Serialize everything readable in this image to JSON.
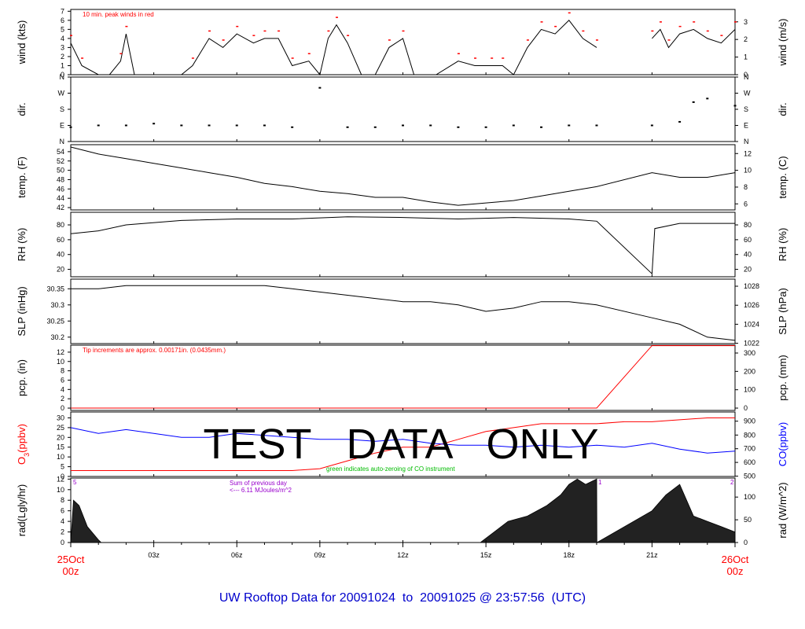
{
  "footer_title": "UW Rooftop Data for 20091024  to  20091025 @ 23:57:56  (UTC)",
  "watermark": "TEST   DATA   ONLY",
  "x_axis": {
    "ticks": [
      "03z",
      "06z",
      "09z",
      "12z",
      "15z",
      "18z",
      "21z"
    ],
    "start_top": "25Oct",
    "start_bottom": "00z",
    "end_top": "26Oct",
    "end_bottom": "00z"
  },
  "colors": {
    "red": "#ff0000",
    "blue": "#0000ff",
    "green": "#00bb00",
    "purple": "#9900cc",
    "navy": "#0000cc"
  },
  "chart_data": [
    {
      "type": "line",
      "id": "wind",
      "ylabel_left": "wind (kts)",
      "ylabel_right": "wind (m/s)",
      "ylim": [
        0,
        7.2
      ],
      "yticks": [
        0,
        1,
        2,
        3,
        4,
        5,
        6,
        7
      ],
      "yticks_right": [
        "0",
        "1",
        "2",
        "3"
      ],
      "right_tick_values": [
        0,
        1.944,
        3.888,
        5.832
      ],
      "annotation": "10 min. peak winds in red",
      "series": [
        {
          "name": "wind",
          "x": [
            0,
            0.4,
            1.0,
            1.4,
            1.8,
            2.0,
            2.3,
            3.0,
            3.6,
            4.0,
            4.4,
            5.0,
            5.5,
            6.0,
            6.6,
            7.0,
            7.5,
            8.0,
            8.6,
            9.0,
            9.3,
            9.6,
            10.0,
            10.5,
            11.0,
            11.5,
            12.0,
            12.4,
            12.8,
            13.2,
            14.0,
            14.6,
            15.2,
            15.6,
            16.0,
            16.5,
            17.0,
            17.5,
            18.0,
            18.5,
            19.0
          ],
          "y": [
            3.5,
            1,
            0,
            0,
            1.5,
            4.5,
            0,
            0,
            0,
            0,
            1,
            4,
            3,
            4.5,
            3.5,
            4,
            4,
            1,
            1.5,
            0,
            4,
            5.5,
            3.5,
            0,
            0,
            3,
            4,
            0,
            0,
            0,
            1.5,
            1,
            1,
            1,
            0,
            3,
            5,
            4.5,
            6,
            4,
            3
          ]
        },
        {
          "name": "wind (2)",
          "x": [
            21,
            21.3,
            21.6,
            22,
            22.5,
            23,
            23.5,
            24
          ],
          "y": [
            4,
            5,
            3,
            4.5,
            5,
            4,
            3.5,
            5
          ]
        }
      ]
    },
    {
      "type": "scatter",
      "id": "dir",
      "ylabel_left": "dir.",
      "ylabel_right": "dir.",
      "yticks_labels": [
        "N",
        "E",
        "S",
        "W",
        "N"
      ],
      "series": [
        {
          "name": "dir",
          "x": [
            0,
            1,
            2,
            3,
            4,
            5,
            6,
            7,
            8,
            9,
            10,
            11,
            12,
            13,
            14,
            15,
            16,
            17,
            18,
            19,
            21,
            22,
            22.5,
            23,
            24
          ],
          "y": [
            80,
            90,
            90,
            100,
            90,
            90,
            90,
            90,
            80,
            300,
            80,
            80,
            90,
            90,
            80,
            80,
            90,
            80,
            90,
            90,
            90,
            110,
            220,
            240,
            200
          ]
        }
      ]
    },
    {
      "type": "line",
      "id": "temp",
      "ylabel_left": "temp. (F)",
      "ylabel_right": "temp. (C)",
      "ylim": [
        41.5,
        55.5
      ],
      "yticks": [
        42,
        44,
        46,
        48,
        50,
        52,
        54
      ],
      "yticks_right": [
        "6",
        "8",
        "10",
        "12"
      ],
      "right_tick_values": [
        42.8,
        46.4,
        50,
        53.6
      ],
      "series": [
        {
          "name": "temp",
          "x": [
            0,
            1,
            2,
            3,
            4,
            5,
            6,
            7,
            8,
            9,
            10,
            11,
            12,
            13,
            14,
            15,
            16,
            17,
            18,
            19,
            21,
            22,
            23,
            24
          ],
          "y": [
            55,
            53.5,
            52.5,
            51.5,
            50.5,
            49.5,
            48.5,
            47.2,
            46.5,
            45.5,
            45,
            44.2,
            44.2,
            43.2,
            42.5,
            43,
            43.5,
            44.5,
            45.5,
            46.5,
            49.5,
            48.5,
            48.5,
            49.5
          ]
        }
      ]
    },
    {
      "type": "line",
      "id": "rh",
      "ylabel_left": "RH (%)",
      "ylabel_right": "RH (%)",
      "ylim": [
        10,
        97
      ],
      "yticks": [
        20,
        40,
        60,
        80
      ],
      "yticks_right": [
        "20",
        "40",
        "60",
        "80"
      ],
      "right_tick_values": [
        20,
        40,
        60,
        80
      ],
      "series": [
        {
          "name": "rh",
          "x": [
            0,
            1,
            2,
            4,
            6,
            8,
            10,
            12,
            14,
            16,
            18,
            19,
            21,
            21.1,
            22,
            24
          ],
          "y": [
            68,
            72,
            80,
            86,
            88,
            88,
            91,
            90,
            88,
            90,
            88,
            85,
            14,
            75,
            82,
            82
          ]
        }
      ]
    },
    {
      "type": "line",
      "id": "slp",
      "ylabel_left": "SLP (inHg)",
      "ylabel_right": "SLP (hPa)",
      "ylim": [
        30.18,
        30.38
      ],
      "yticks": [
        30.2,
        30.25,
        30.3,
        30.35
      ],
      "yticks_right": [
        "1022",
        "1024",
        "1026",
        "1028"
      ],
      "right_tick_values": [
        30.181,
        30.24,
        30.299,
        30.358
      ],
      "series": [
        {
          "name": "slp",
          "x": [
            0,
            1,
            2,
            3,
            4,
            5,
            6,
            7,
            8,
            9,
            10,
            11,
            12,
            13,
            14,
            15,
            16,
            17,
            18,
            19,
            21,
            22,
            23,
            24
          ],
          "y": [
            30.35,
            30.35,
            30.36,
            30.36,
            30.36,
            30.36,
            30.36,
            30.36,
            30.35,
            30.34,
            30.33,
            30.32,
            30.31,
            30.31,
            30.3,
            30.28,
            30.29,
            30.31,
            30.31,
            30.3,
            30.26,
            30.24,
            30.2,
            30.19
          ]
        }
      ]
    },
    {
      "type": "line",
      "id": "pcp",
      "ylabel_left": "pcp. (in)",
      "ylabel_right": "pcp. (mm)",
      "ylim": [
        -0.5,
        13.5
      ],
      "yticks": [
        0,
        2,
        4,
        6,
        8,
        10,
        12
      ],
      "yticks_right": [
        "0",
        "100",
        "200",
        "300"
      ],
      "right_tick_values": [
        0,
        3.937,
        7.874,
        11.811
      ],
      "annotation": "Tip increments are approx. 0.00171in. (0.0435mm.)",
      "series": [
        {
          "name": "pcp",
          "x": [
            0,
            19,
            21,
            24
          ],
          "y": [
            0,
            0,
            13.4,
            13.4
          ]
        }
      ]
    },
    {
      "type": "line",
      "id": "chem",
      "ylabel_left": "O3(ppbv)",
      "ylabel_right": "CO(ppbv)",
      "ylim": [
        0,
        33
      ],
      "yticks": [
        0,
        5,
        10,
        15,
        20,
        25,
        30
      ],
      "yticks_right": [
        "500",
        "600",
        "700",
        "800",
        "900"
      ],
      "right_tick_values": [
        0.15,
        7.2,
        14.2,
        21.2,
        28.3
      ],
      "annotation": "green indicates auto-zeroing of CO instrument",
      "series": [
        {
          "name": "O3",
          "x": [
            0,
            2,
            4,
            6,
            8,
            9,
            10,
            11,
            12,
            13,
            14,
            15,
            16,
            17,
            18,
            19,
            20,
            21,
            22,
            23,
            24
          ],
          "y": [
            3,
            3,
            3,
            3,
            3,
            4,
            8,
            12,
            15,
            15,
            19,
            23,
            25,
            27,
            27,
            27,
            28,
            28,
            29,
            30,
            30
          ]
        },
        {
          "name": "CO",
          "x": [
            0,
            1,
            2,
            3,
            4,
            5,
            6,
            7,
            8,
            9,
            10,
            11,
            12,
            13,
            14,
            15,
            16,
            17,
            18,
            19,
            20,
            21,
            22,
            23,
            24
          ],
          "y": [
            25,
            22,
            24,
            22,
            20,
            20,
            22,
            21,
            20,
            19,
            19,
            18,
            19,
            17,
            16,
            16,
            15,
            16,
            15,
            16,
            15,
            17,
            14,
            12,
            13
          ]
        }
      ]
    },
    {
      "type": "area",
      "id": "rad",
      "ylabel_left": "rad(Lgly/hr)",
      "ylabel_right": "rad (W/m^2)",
      "ylim": [
        0,
        12.2
      ],
      "yticks": [
        0,
        2,
        4,
        6,
        8,
        10,
        12
      ],
      "yticks_right": [
        "0",
        "50",
        "100"
      ],
      "right_tick_values": [
        0,
        4.3,
        8.6
      ],
      "annotation_lines": [
        "Sum of previous day",
        "<--- 6.11 MJoules/m^2"
      ],
      "markers": [
        "5",
        "1",
        "2"
      ],
      "series": [
        {
          "name": "rad",
          "x": [
            0,
            0.1,
            0.3,
            0.6,
            1.0,
            1.1,
            14.8,
            15.3,
            15.8,
            16.5,
            17.2,
            17.7,
            18.0,
            18.3,
            18.6,
            19.0,
            19.01,
            21.0,
            21.5,
            22.0,
            22.5,
            23.0,
            23.5,
            24.0
          ],
          "y": [
            0,
            8,
            7,
            3,
            0.5,
            0,
            0,
            2,
            4,
            5,
            7,
            9,
            11,
            12,
            11,
            12,
            0,
            6,
            9,
            11,
            5,
            4,
            3,
            2
          ]
        }
      ]
    }
  ]
}
